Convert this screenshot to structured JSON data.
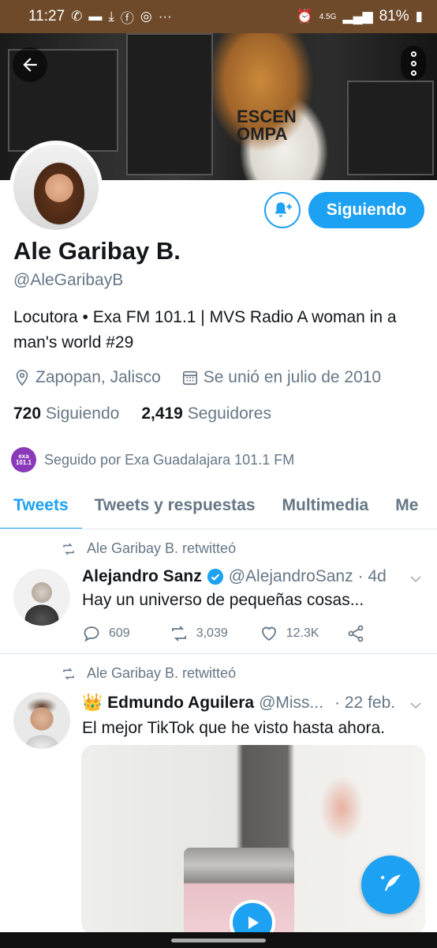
{
  "status_bar": {
    "time": "11:27",
    "network": "4.5G",
    "battery": "81%",
    "icons": [
      "whatsapp-icon",
      "message-icon",
      "download-icon",
      "facebook-icon",
      "instagram-icon",
      "more-icon",
      "alarm-icon",
      "signal-icon",
      "battery-icon"
    ]
  },
  "banner": {
    "shirt_text_1": "ESCEN",
    "shirt_text_2": "OMPA"
  },
  "profile": {
    "name": "Ale Garibay B.",
    "handle": "@AleGaribayB",
    "bio": "Locutora • Exa FM 101.1 | MVS Radio A woman in a man's world #29",
    "location": "Zapopan, Jalisco",
    "joined": "Se unió en julio de 2010",
    "following_count": "720",
    "following_label": "Siguiendo",
    "followers_count": "2,419",
    "followers_label": "Seguidores",
    "followed_by": "Seguido por Exa Guadalajara 101.1 FM",
    "followed_by_avatar_text": "exa 101.1",
    "follow_button": "Siguiendo"
  },
  "tabs": [
    "Tweets",
    "Tweets y respuestas",
    "Multimedia",
    "Me"
  ],
  "tweets": [
    {
      "retweeted_by": "Ale Garibay B. retwitteó",
      "author": "Alejandro Sanz",
      "handle": "@AlejandroSanz",
      "time": "· 4d",
      "text": "Hay un universo de pequeñas cosas...",
      "replies": "609",
      "retweets": "3,039",
      "likes": "12.3K"
    },
    {
      "retweeted_by": "Ale Garibay B. retwitteó",
      "author_emoji": "👑",
      "author": "Edmundo Aguilera",
      "handle": "@Miss...",
      "time": "· 22 feb.",
      "text": "El mejor TikTok que he visto hasta ahora."
    }
  ],
  "colors": {
    "accent": "#1da1f2",
    "status_bar": "#6e4a2a",
    "muted": "#657786"
  }
}
